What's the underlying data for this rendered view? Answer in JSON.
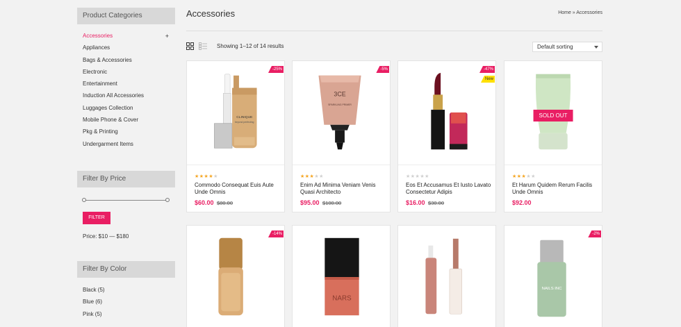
{
  "sidebar": {
    "categories_title": "Product Categories",
    "categories": [
      {
        "label": "Accessories",
        "active": true
      },
      {
        "label": "Appliances"
      },
      {
        "label": "Bags & Accessories"
      },
      {
        "label": "Electronic"
      },
      {
        "label": "Entertainment"
      },
      {
        "label": "Induction All Accessories"
      },
      {
        "label": "Luggages Collection"
      },
      {
        "label": "Mobile Phone & Cover"
      },
      {
        "label": "Pkg & Printing"
      },
      {
        "label": "Undergarment Items"
      }
    ],
    "expand_symbol": "+",
    "price_title": "Filter By Price",
    "filter_button": "FILTER",
    "price_range": "Price: $10 — $180",
    "color_title": "Filter By Color",
    "colors": [
      "Black (5)",
      "Blue (6)",
      "Pink (5)"
    ]
  },
  "main": {
    "title": "Accessories",
    "breadcrumb": "Home  » Accessories",
    "results": "Showing 1–12 of 14 results",
    "sort": "Default sorting",
    "accent_color": "#e91e63"
  },
  "products": [
    {
      "name": "Commodo Consequat Euis Aute Unde Omnis",
      "price": "$60.00",
      "old_price": "$80.00",
      "badge": "-25%",
      "rating": 4
    },
    {
      "name": "Enim Ad Minima Veniam Venis Quasi Architecto",
      "price": "$95.00",
      "old_price": "$100.00",
      "badge": "-5%",
      "rating": 3
    },
    {
      "name": "Eos Et Accusamus Et Iusto Lavato Consectetur Adipis",
      "price": "$16.00",
      "old_price": "$30.00",
      "badge": "-47%",
      "badge2": "New",
      "rating": 0
    },
    {
      "name": "Et Harum Quidem Rerum Facilis Unde Omnis",
      "price": "$92.00",
      "old_price": "",
      "badge": "",
      "soldout": "SOLD OUT",
      "rating": 3
    },
    {
      "badge": "-14%"
    },
    {
      "badge": ""
    },
    {
      "badge": ""
    },
    {
      "badge": "-2%"
    }
  ],
  "labels": {
    "clinique_brand": "CLINIQUE",
    "clinique_line": "beyond perfecting",
    "ce_brand": "3CE",
    "ce_line": "SPARKLING PRIMER",
    "nars": "NARS",
    "nails": "NAILS INC"
  }
}
